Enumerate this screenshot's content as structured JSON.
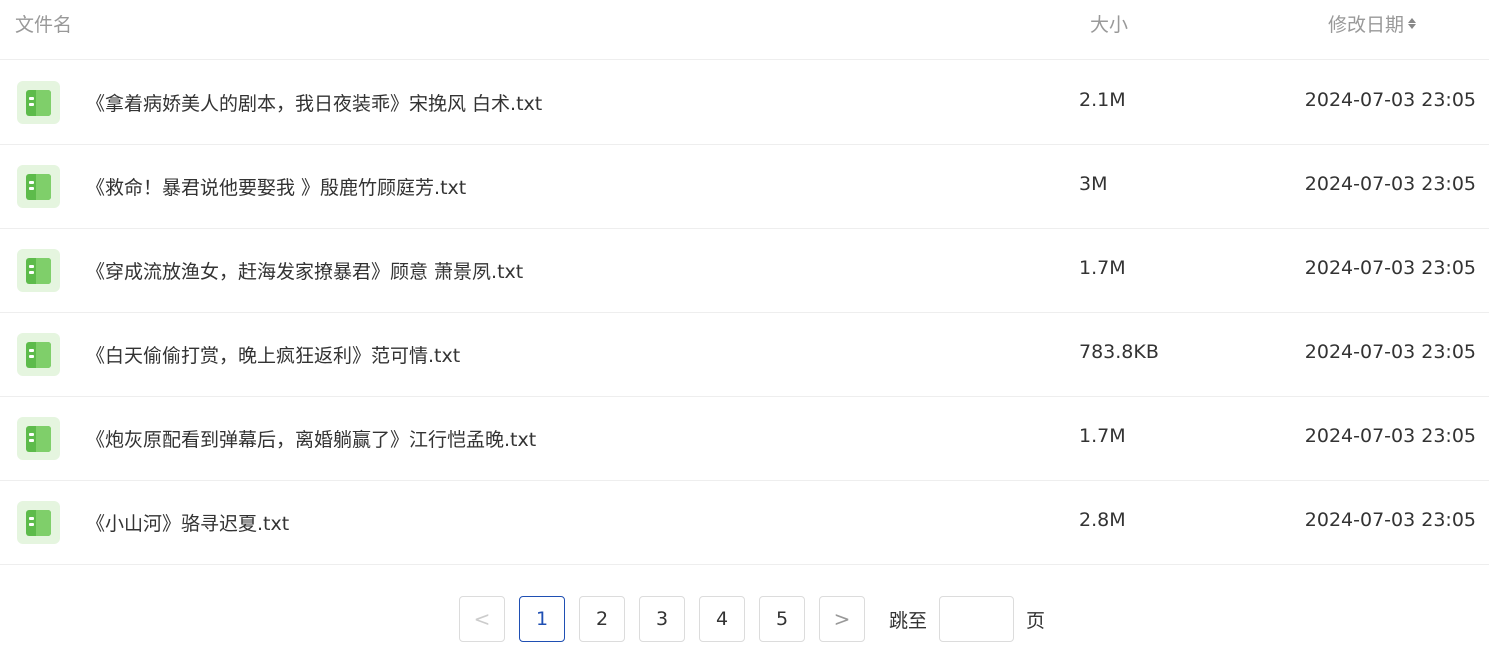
{
  "header": {
    "name_label": "文件名",
    "size_label": "大小",
    "date_label": "修改日期"
  },
  "files": [
    {
      "name": "《拿着病娇美人的剧本，我日夜装乖》宋挽风 白术.txt",
      "size": "2.1M",
      "date": "2024-07-03 23:05"
    },
    {
      "name": "《救命！暴君说他要娶我 》殷鹿竹顾庭芳.txt",
      "size": "3M",
      "date": "2024-07-03 23:05"
    },
    {
      "name": "《穿成流放渔女，赶海发家撩暴君》顾意 萧景夙.txt",
      "size": "1.7M",
      "date": "2024-07-03 23:05"
    },
    {
      "name": "《白天偷偷打赏，晚上疯狂返利》范可情.txt",
      "size": "783.8KB",
      "date": "2024-07-03 23:05"
    },
    {
      "name": "《炮灰原配看到弹幕后，离婚躺赢了》江行恺孟晚.txt",
      "size": "1.7M",
      "date": "2024-07-03 23:05"
    },
    {
      "name": "《小山河》骆寻迟夏.txt",
      "size": "2.8M",
      "date": "2024-07-03 23:05"
    }
  ],
  "pagination": {
    "prev": "<",
    "next": ">",
    "pages": [
      "1",
      "2",
      "3",
      "4",
      "5"
    ],
    "current": "1",
    "jump_label": "跳至",
    "jump_value": "",
    "page_suffix": "页"
  },
  "colors": {
    "accent": "#1f4fb3",
    "icon_bg": "#e5f5df",
    "icon_green": "#5dbb4b",
    "muted_text": "#999999"
  }
}
